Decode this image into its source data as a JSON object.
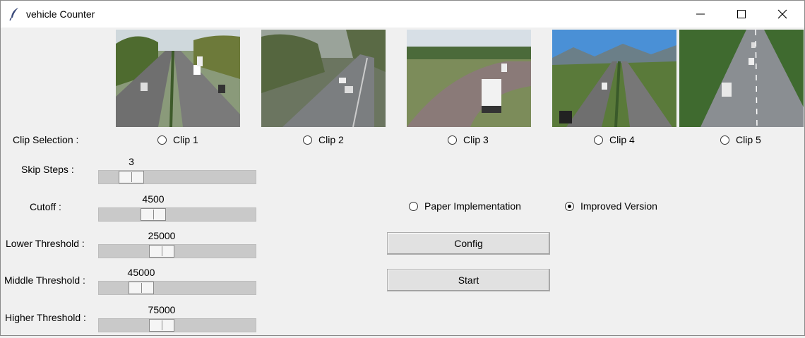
{
  "window": {
    "title": "vehicle Counter",
    "icon": "feather-icon",
    "controls": [
      "minimize-icon",
      "maximize-icon",
      "close-icon"
    ]
  },
  "clips": {
    "label": "Clip Selection :",
    "items": [
      {
        "label": "Clip 1",
        "selected": false
      },
      {
        "label": "Clip 2",
        "selected": false
      },
      {
        "label": "Clip 3",
        "selected": false
      },
      {
        "label": "Clip 4",
        "selected": false
      },
      {
        "label": "Clip 5",
        "selected": false
      }
    ]
  },
  "sliders": [
    {
      "label": "Skip Steps :",
      "value": "3"
    },
    {
      "label": "Cutoff :",
      "value": "4500"
    },
    {
      "label": "Lower Threshold :",
      "value": "25000"
    },
    {
      "label": "Middle Threshold :",
      "value": "45000"
    },
    {
      "label": "Higher Threshold :",
      "value": "75000"
    }
  ],
  "mode": {
    "options": [
      {
        "label": "Paper Implementation",
        "selected": false
      },
      {
        "label": "Improved Version",
        "selected": true
      }
    ]
  },
  "buttons": {
    "config": "Config",
    "start": "Start"
  }
}
